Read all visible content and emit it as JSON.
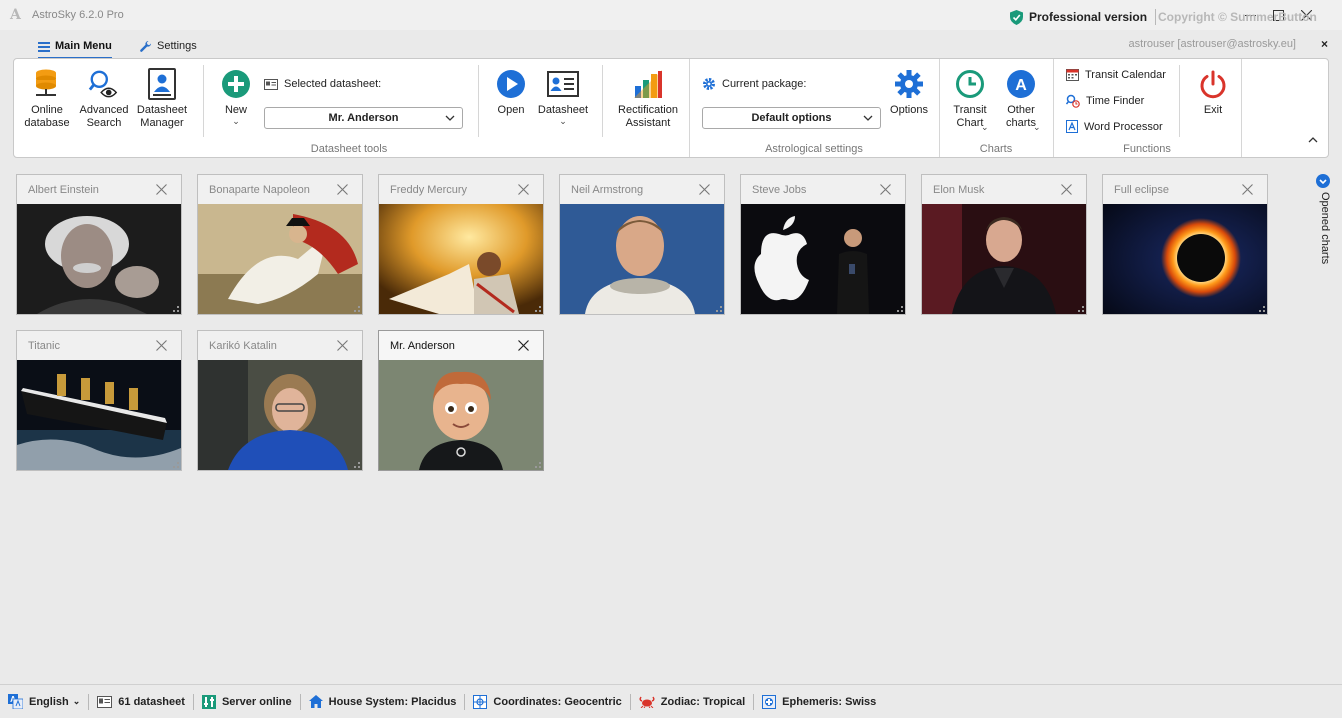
{
  "window": {
    "title": "AstroSky 6.2.0 Pro",
    "logo_letter": "A"
  },
  "menu": {
    "tabs": [
      {
        "label": "Main Menu",
        "icon": "hamburger-icon",
        "active": true
      },
      {
        "label": "Settings",
        "icon": "wrench-icon",
        "active": false
      }
    ],
    "user": "astrouser [astrouser@astrosky.eu]",
    "close": "×"
  },
  "ribbon": {
    "online_database": "Online database",
    "advanced_search": "Advanced Search",
    "datasheet_manager": "Datasheet Manager",
    "new": "New",
    "selected_datasheet_label": "Selected datasheet:",
    "selected_datasheet_value": "Mr. Anderson",
    "open": "Open",
    "datasheet": "Datasheet",
    "rectification_assistant": "Rectification Assistant",
    "group_datasheet_tools": "Datasheet tools",
    "current_package_label": "Current package:",
    "current_package_value": "Default options",
    "options": "Options",
    "group_astrological_settings": "Astrological settings",
    "transit_chart": "Transit Chart",
    "other_charts": "Other charts",
    "group_charts": "Charts",
    "transit_calendar": "Transit Calendar",
    "time_finder": "Time Finder",
    "word_processor": "Word Processor",
    "exit": "Exit",
    "group_functions": "Functions",
    "other_charts_badge": "A"
  },
  "charts_panel": {
    "side_label": "Opened charts",
    "cards": [
      {
        "title": "Albert Einstein",
        "active": false
      },
      {
        "title": "Bonaparte Napoleon",
        "active": false
      },
      {
        "title": "Freddy Mercury",
        "active": false
      },
      {
        "title": "Neil Armstrong",
        "active": false
      },
      {
        "title": "Steve Jobs",
        "active": false
      },
      {
        "title": "Elon Musk",
        "active": false
      },
      {
        "title": "Full eclipse",
        "active": false
      },
      {
        "title": "Titanic",
        "active": false
      },
      {
        "title": "Karikó Katalin",
        "active": false
      },
      {
        "title": "Mr. Anderson",
        "active": true
      }
    ]
  },
  "statusbar": {
    "language": "English",
    "datasheets": "61 datasheet",
    "server": "Server online",
    "house_system": "House System: Placidus",
    "coordinates": "Coordinates: Geocentric",
    "zodiac": "Zodiac: Tropical",
    "ephemeris": "Ephemeris: Swiss",
    "version": "Professional version",
    "copyright": "Copyright © SummerButton"
  },
  "colors": {
    "accent": "#2a6fc9",
    "teal": "#1a9a7a",
    "red": "#d9342b",
    "orange": "#f39c12"
  }
}
